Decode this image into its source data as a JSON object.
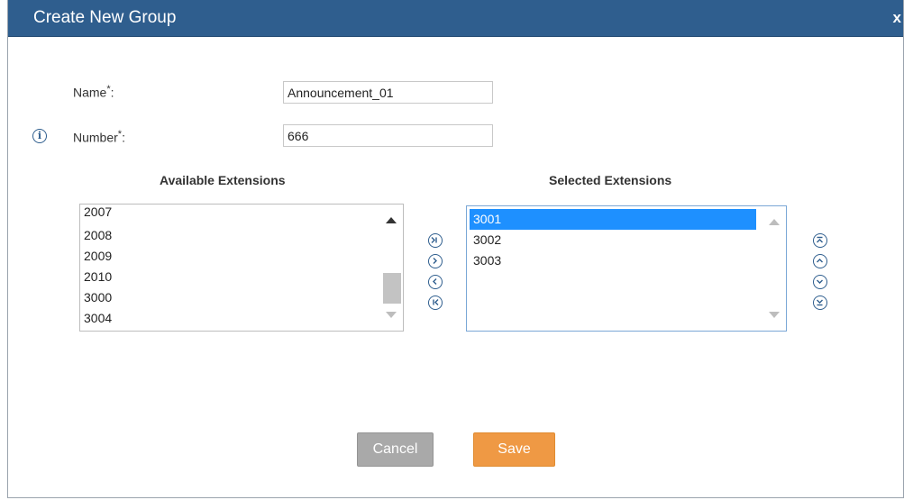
{
  "dialog": {
    "title": "Create New Group",
    "close_label": "x"
  },
  "form": {
    "name_label": "Name",
    "name_required": "*",
    "name_colon": ":",
    "name_value": "Announcement_01",
    "number_label": "Number",
    "number_required": "*",
    "number_colon": ":",
    "number_value": "666"
  },
  "available": {
    "heading": "Available Extensions",
    "items": [
      "2007",
      "2008",
      "2009",
      "2010",
      "3000",
      "3004"
    ]
  },
  "selected": {
    "heading": "Selected Extensions",
    "items": [
      "3001",
      "3002",
      "3003"
    ],
    "highlighted_index": 0
  },
  "transfer_icons": [
    "move-all-right-icon",
    "move-right-icon",
    "move-left-icon",
    "move-all-left-icon"
  ],
  "order_icons": [
    "move-to-top-icon",
    "move-up-icon",
    "move-down-icon",
    "move-to-bottom-icon"
  ],
  "buttons": {
    "cancel_label": "Cancel",
    "save_label": "Save"
  },
  "colors": {
    "titlebar": "#2f5e8e",
    "save": "#ef9944",
    "cancel": "#a9a9a9",
    "selection": "#1e90ff"
  }
}
